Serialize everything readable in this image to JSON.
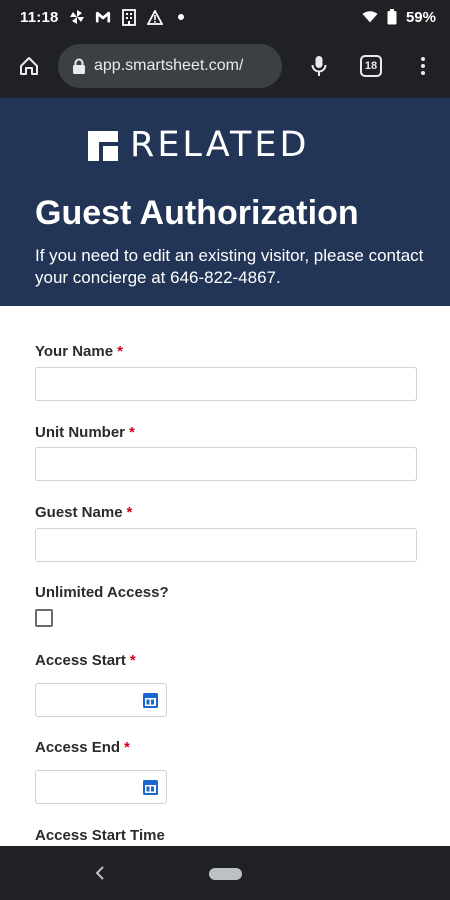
{
  "status_bar": {
    "time": "11:18",
    "battery": "59%",
    "icons_left": [
      "pinwheel-icon",
      "gmail-icon",
      "building-icon",
      "alert-icon",
      "dot-icon"
    ],
    "icons_right": [
      "wifi-icon",
      "battery-icon"
    ]
  },
  "browser": {
    "url": "app.smartsheet.com/",
    "tab_count": "18"
  },
  "header": {
    "logo_text": "RELATED",
    "title": "Guest Authorization",
    "description": "If you need to edit an existing visitor, please contact your concierge at 646-822-4867."
  },
  "form": {
    "fields": [
      {
        "label": "Your Name",
        "required": "*",
        "value": ""
      },
      {
        "label": "Unit Number",
        "required": "*",
        "value": ""
      },
      {
        "label": "Guest Name",
        "required": "*",
        "value": ""
      }
    ],
    "unlimited_access": {
      "label": "Unlimited Access?",
      "checked": false
    },
    "access_start": {
      "label": "Access Start",
      "required": "*",
      "value": ""
    },
    "access_end": {
      "label": "Access End",
      "required": "*",
      "value": ""
    },
    "access_start_time": {
      "label": "Access Start Time"
    }
  },
  "colors": {
    "banner": "#223556",
    "system_bar": "#202124",
    "required": "#d0021b",
    "calendar_icon": "#1a66d2"
  }
}
